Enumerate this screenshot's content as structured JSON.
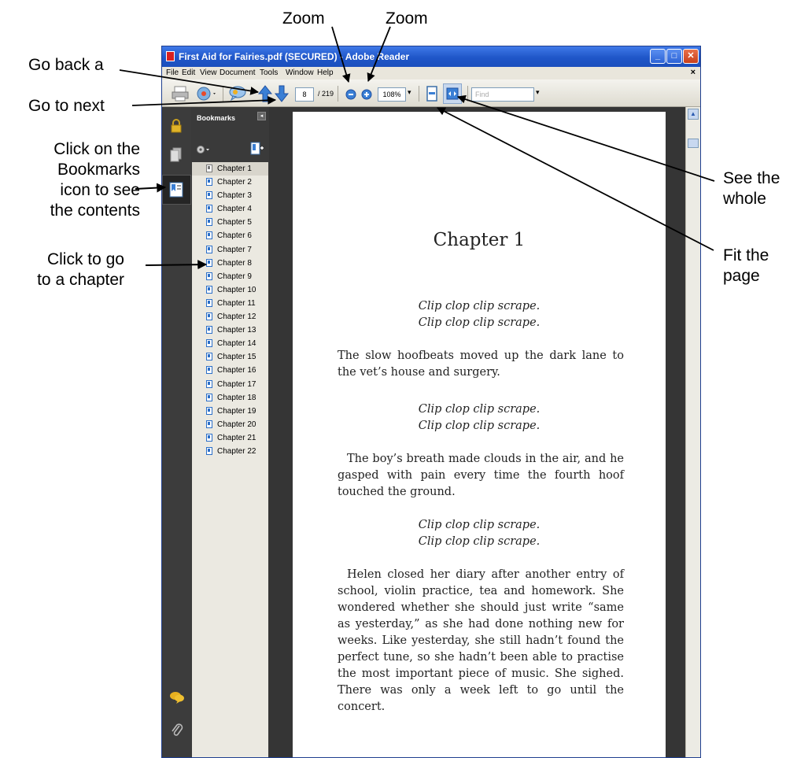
{
  "annotations": {
    "zoom_left": "Zoom",
    "zoom_right": "Zoom",
    "go_back": "Go back a",
    "go_next": "Go to next",
    "bookmarks_line1": "Click on the",
    "bookmarks_line2": "Bookmarks",
    "bookmarks_line3": "icon to see",
    "bookmarks_line4": "the contents",
    "chapter_line1": "Click to go",
    "chapter_line2": "to a chapter",
    "see_line1": "See the",
    "see_line2": "whole",
    "fit_line1": "Fit the",
    "fit_line2": "page"
  },
  "window": {
    "title": "First Aid for Fairies.pdf (SECURED) - Adobe Reader",
    "minimize": "_",
    "maximize": "□",
    "close": "✕"
  },
  "menu": {
    "items": [
      "File",
      "Edit",
      "View",
      "Document",
      "Tools",
      "Window",
      "Help"
    ],
    "close": "×"
  },
  "toolbar": {
    "page_current": "8",
    "page_total": "/ 219",
    "zoom_value": "108%",
    "find_placeholder": "Find"
  },
  "bookmarks": {
    "title": "Bookmarks",
    "collapse": "◂",
    "items": [
      "Chapter 1",
      "Chapter 2",
      "Chapter 3",
      "Chapter 4",
      "Chapter 5",
      "Chapter 6",
      "Chapter 7",
      "Chapter 8",
      "Chapter 9",
      "Chapter 10",
      "Chapter 11",
      "Chapter 12",
      "Chapter 13",
      "Chapter 14",
      "Chapter 15",
      "Chapter 16",
      "Chapter 17",
      "Chapter 18",
      "Chapter 19",
      "Chapter 20",
      "Chapter 21",
      "Chapter 22"
    ]
  },
  "page": {
    "chapter_title": "Chapter 1",
    "verse1_line1": "Clip clop clip scrape.",
    "verse1_line2": "Clip clop clip scrape.",
    "para1": "The slow hoofbeats moved up the dark lane to the vet’s house and surgery.",
    "verse2_line1": "Clip clop clip scrape.",
    "verse2_line2": "Clip clop clip scrape.",
    "para2": "The boy’s breath made clouds in the air, and he gasped with pain every time the fourth hoof touched the ground.",
    "verse3_line1": "Clip clop clip scrape.",
    "verse3_line2": "Clip clop clip scrape.",
    "para3": "Helen closed her diary after another entry of school, violin practice, tea and homework. She wondered whether she should just write “same as yesterday,” as she had done nothing new for weeks. Like yesterday, she still hadn’t found the perfect tune, so she hadn’t been able to practise the most important piece of music. She sighed. There was only a week left to go until the concert."
  },
  "colors": {
    "titlebar": "#1f56c8",
    "sidebar_dark": "#3c3c3c",
    "doc_background": "#353535",
    "arrow_blue": "#3a7fd5"
  },
  "icons": [
    "app-pdf-icon",
    "print-icon",
    "page-setup-icon",
    "comment-icon",
    "previous-page-arrow-icon",
    "next-page-arrow-icon",
    "zoom-out-icon",
    "zoom-in-icon",
    "fit-page-icon",
    "fit-width-icon",
    "lock-icon",
    "pages-icon",
    "bookmarks-icon",
    "comments-icon",
    "attachments-icon",
    "options-gear-icon",
    "new-bookmark-icon"
  ]
}
